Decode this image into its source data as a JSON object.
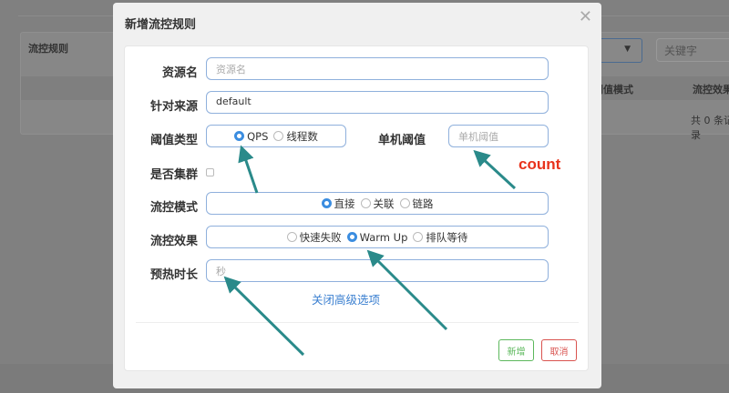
{
  "background": {
    "card_title": "流控规则",
    "keyword_placeholder": "关键字",
    "col_threshold_mode": "阈值模式",
    "col_effect": "流控效果",
    "record_count": "共 0 条记录"
  },
  "modal": {
    "title": "新增流控规则",
    "resource": {
      "label": "资源名",
      "placeholder": "资源名"
    },
    "origin": {
      "label": "针对来源",
      "value": "default"
    },
    "grade": {
      "label": "阈值类型",
      "options": [
        "QPS",
        "线程数"
      ],
      "selected": "QPS"
    },
    "threshold": {
      "label": "单机阈值",
      "placeholder": "单机阈值"
    },
    "cluster": {
      "label": "是否集群",
      "checked": false
    },
    "strategy": {
      "label": "流控模式",
      "options": [
        "直接",
        "关联",
        "链路"
      ],
      "selected": "直接"
    },
    "effect": {
      "label": "流控效果",
      "options": [
        "快速失败",
        "Warm Up",
        "排队等待"
      ],
      "selected": "Warm Up"
    },
    "warmup": {
      "label": "预热时长",
      "placeholder": "秒"
    },
    "advanced_link": "关闭高级选项",
    "add_button": "新增",
    "cancel_button": "取消"
  },
  "annotation": {
    "text": "count",
    "color": "#e8331c",
    "arrow_color": "#2a8a8a"
  }
}
